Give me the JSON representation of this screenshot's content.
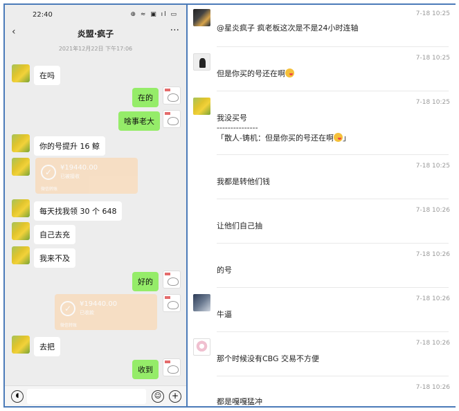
{
  "phone": {
    "status_time": "22:40",
    "status_icons": "⊕ ≈ ▣ ıl ▭",
    "back_icon": "‹",
    "chat_title": "炎盟·疯子",
    "more_icon": "···",
    "date": "2021年12月22日 下午17:06",
    "messages": [
      {
        "side": "left",
        "text": "在吗"
      },
      {
        "side": "right",
        "text": "在的"
      },
      {
        "side": "right",
        "text": "啥事老大"
      },
      {
        "side": "left",
        "text": "你的号提升 16 鲸"
      },
      {
        "side": "left",
        "type": "transfer",
        "amount": "¥19440.00",
        "status": "已被接收",
        "footer": "微信转账"
      },
      {
        "side": "left",
        "text": "每天找我领 30 个 648"
      },
      {
        "side": "left",
        "text": "自己去充"
      },
      {
        "side": "left",
        "text": "我来不及"
      },
      {
        "side": "right",
        "text": "好的"
      },
      {
        "side": "right",
        "type": "transfer",
        "amount": "¥19440.00",
        "status": "已收款",
        "footer": "微信转账"
      },
      {
        "side": "left",
        "text": "去把"
      },
      {
        "side": "right",
        "text": "收到"
      }
    ],
    "input": {
      "voice_icon": "voice-icon",
      "emoji_icon": "emoji-icon",
      "plus_icon": "plus-icon"
    }
  },
  "log": {
    "entries": [
      {
        "time": "7-18 10:25",
        "avatar": "dark-game-avatar",
        "lines": [
          "@星炎疯子 疯老板这次是不是24小时连轴"
        ]
      },
      {
        "time": "7-18 10:25",
        "avatar": "person-sketch-avatar",
        "lines": [
          "但是你买的号还在啊"
        ],
        "emoji": true
      },
      {
        "time": "7-18 10:25",
        "avatar": "yellow-avatar",
        "lines": [
          "我没买号",
          "---------------",
          "「散人-铸机：但是你买的号还在啊",
          "」"
        ],
        "emoji_line": 2
      },
      {
        "time": "7-18 10:25",
        "lines": [
          "我都是转他们钱"
        ]
      },
      {
        "time": "7-18 10:26",
        "lines": [
          "让他们自己抽"
        ]
      },
      {
        "time": "7-18 10:26",
        "lines": [
          "的号"
        ]
      },
      {
        "time": "7-18 10:26",
        "avatar": "dark-photo-avatar",
        "lines": [
          "牛逼"
        ]
      },
      {
        "time": "7-18 10:26",
        "avatar": "pink-cat-avatar",
        "lines": [
          "那个时候没有CBG  交易不方便"
        ]
      },
      {
        "time": "7-18 10:26",
        "lines": [
          "都是嘎嘎猛冲"
        ]
      }
    ]
  }
}
